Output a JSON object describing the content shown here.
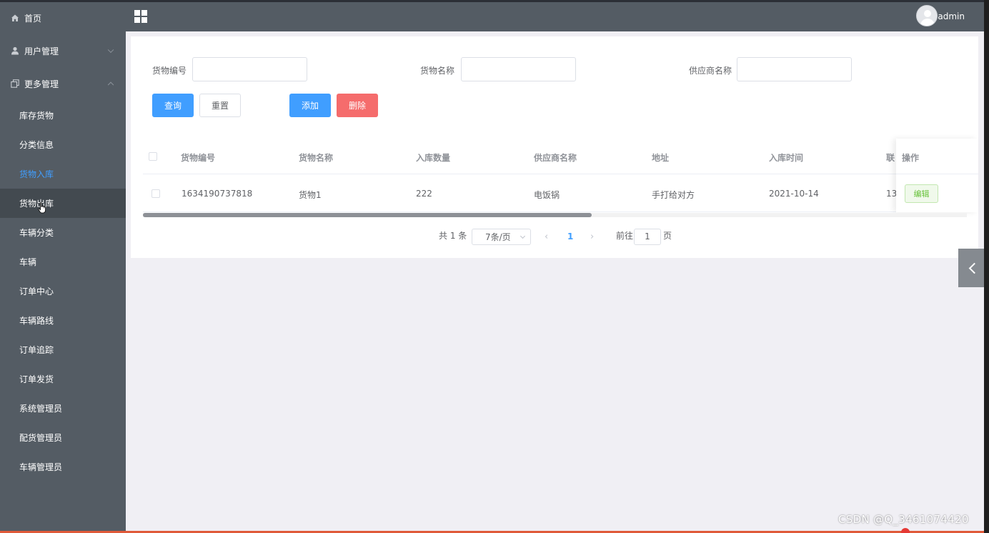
{
  "header": {
    "user_name": "admin"
  },
  "sidebar": {
    "home": "首页",
    "user_mgmt": "用户管理",
    "more_mgmt": "更多管理",
    "items": [
      "库存货物",
      "分类信息",
      "货物入库",
      "货物出库",
      "车辆分类",
      "车辆",
      "订单中心",
      "车辆路线",
      "订单追踪",
      "订单发货",
      "系统管理员",
      "配货管理员",
      "车辆管理员"
    ]
  },
  "search": {
    "label_code": "货物编号",
    "label_name": "货物名称",
    "label_supplier": "供应商名称"
  },
  "buttons": {
    "query": "查询",
    "reset": "重置",
    "add": "添加",
    "delete": "删除"
  },
  "table": {
    "headers": [
      "货物编号",
      "货物名称",
      "入库数量",
      "供应商名称",
      "地址",
      "入库时间",
      "联"
    ],
    "op_header": "操作",
    "rows": [
      {
        "code": "1634190737818",
        "name": "货物1",
        "qty": "222",
        "supplier": "电饭锅",
        "address": "手打给对方",
        "time": "2021-10-14",
        "contact": "13"
      }
    ],
    "edit_label": "编辑"
  },
  "pagination": {
    "total": "共 1 条",
    "page_size": "7条/页",
    "current": "1",
    "goto_prefix": "前往",
    "goto_value": "1",
    "goto_suffix": "页"
  },
  "watermark": "CSDN @Q_3461074420"
}
